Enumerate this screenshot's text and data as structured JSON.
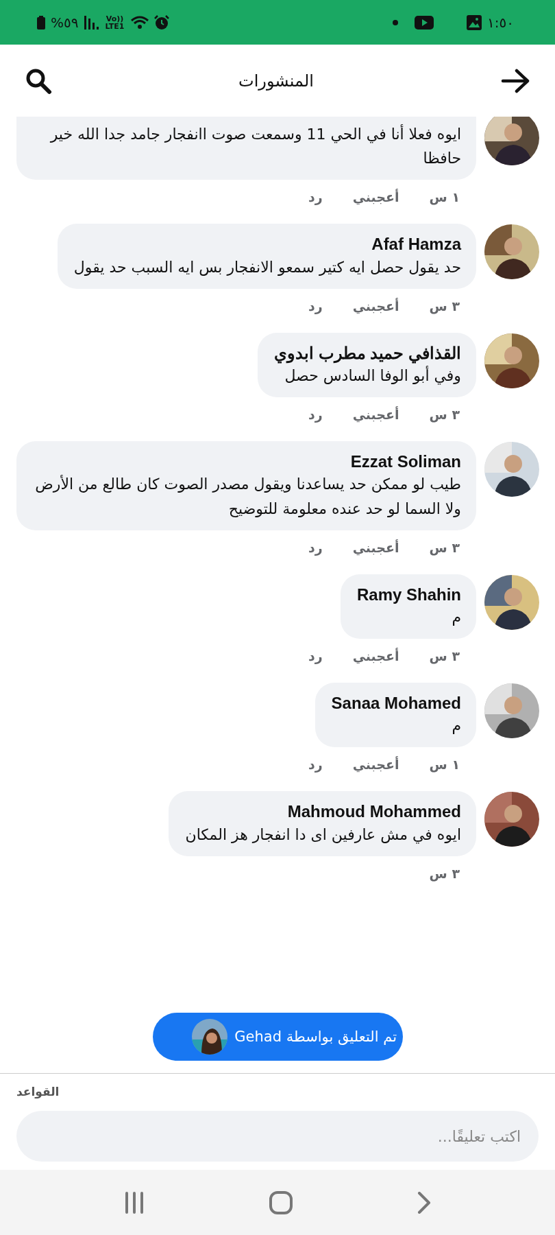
{
  "status_bar": {
    "battery": "%٥٩",
    "network": "Vo)) LTE1",
    "time": "١:٥٠"
  },
  "header": {
    "title": "المنشورات"
  },
  "comments": [
    {
      "text": "ايوه فعلا أنا في الحي 11  وسمعت صوت اانفجار جامد جدا  الله خير حافظا",
      "time": "١ س",
      "like": "أعجبني",
      "reply": "رد"
    },
    {
      "name": "Afaf Hamza",
      "text": "حد يقول حصل ايه كتير سمعو الانفجار بس ايه السبب حد يقول",
      "time": "٣ س",
      "like": "أعجبني",
      "reply": "رد"
    },
    {
      "name": "القذافي حميد مطرب ابدوي",
      "text": "وفي أبو الوفا السادس حصل",
      "time": "٣ س",
      "like": "أعجبني",
      "reply": "رد"
    },
    {
      "name": "Ezzat Soliman",
      "text": "طيب لو ممكن حد يساعدنا ويقول مصدر الصوت كان طالع من الأرض ولا السما لو حد عنده معلومة للتوضيح",
      "time": "٣ س",
      "like": "أعجبني",
      "reply": "رد"
    },
    {
      "name": "Ramy Shahin",
      "text": "م",
      "time": "٣ س",
      "like": "أعجبني",
      "reply": "رد"
    },
    {
      "name": "Sanaa Mohamed",
      "text": "م",
      "time": "١ س",
      "like": "أعجبني",
      "reply": "رد"
    },
    {
      "name": "Mahmoud Mohammed",
      "text": "ايوه في مش عارفين اى دا انفجار هز المكان",
      "time": "٣ س"
    }
  ],
  "toast": {
    "text": "تم التعليق بواسطة Gehad"
  },
  "rules_link": "القواعد",
  "comment_input": {
    "placeholder": "اكتب تعليقًا..."
  }
}
